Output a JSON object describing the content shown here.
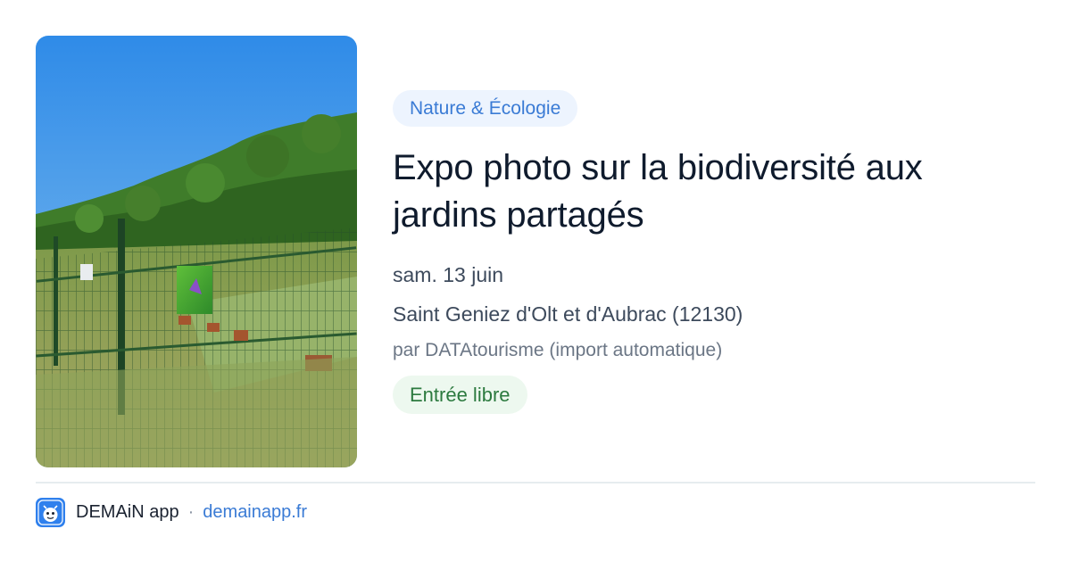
{
  "event": {
    "category": "Nature & Écologie",
    "title_line1": "Expo photo sur la biodiversité aux",
    "title_line2": "jardins partagés",
    "date": "sam. 13 juin",
    "location": "Saint Geniez d'Olt et d'Aubrac (12130)",
    "source": "par DATAtourisme (import automatique)",
    "price": "Entrée libre"
  },
  "footer": {
    "app_name": "DEMAiN app",
    "separator": "·",
    "domain": "demainapp.fr"
  },
  "icons": {
    "app_logo": "demain-app-logo-icon"
  },
  "colors": {
    "category_bg": "#edf4fe",
    "category_text": "#3a7bd5",
    "price_bg": "#edf8ef",
    "price_text": "#2c7a3f",
    "link": "#3a7bd5",
    "logo_blue": "#2f80ed"
  }
}
